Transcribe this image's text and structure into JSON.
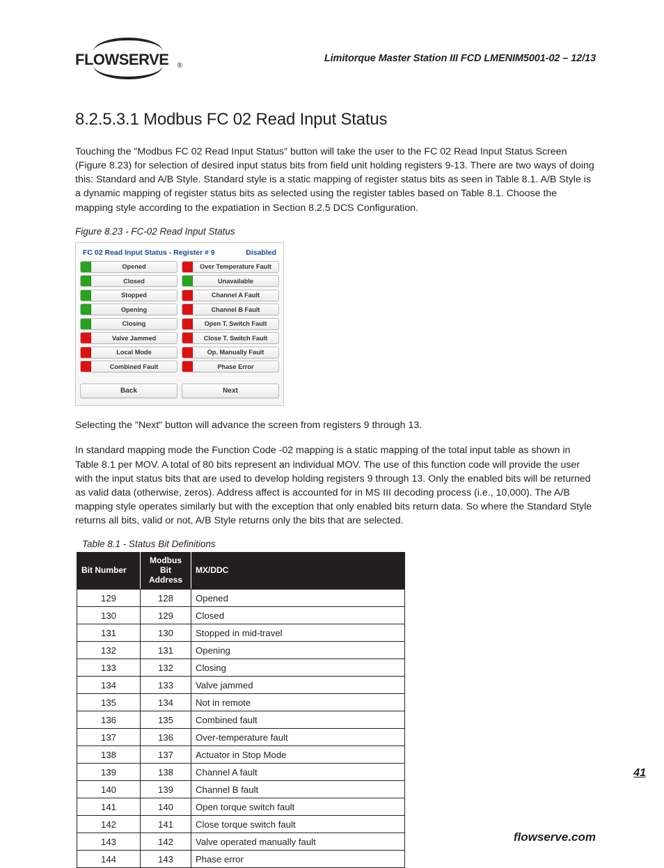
{
  "header": {
    "logo_text": "FLOWSERVE",
    "doc_id": "Limitorque Master Station III    FCD LMENIM5001-02 – 12/13"
  },
  "section": {
    "number_title": "8.2.5.3.1 Modbus FC 02 Read Input Status",
    "para1": "Touching the \"Modbus FC 02 Read Input Status\" button will take the user to the FC 02 Read Input Status Screen (Figure 8.23) for selection of desired input status bits from field unit holding registers 9-13. There are two ways of doing this: Standard and A/B Style. Standard style is a static mapping of register status bits as seen in Table 8.1. A/B Style is a dynamic mapping of register status bits as selected using the register tables based on Table 8.1. Choose the mapping style according to the expatiation in Section 8.2.5 DCS Configuration.",
    "fig_caption": "Figure 8.23 - FC-02 Read Input Status",
    "para2": "Selecting the \"Next\" button will advance the screen from registers 9 through 13.",
    "para3": "In standard mapping mode the Function Code -02 mapping is a static mapping of the total input table as shown in Table 8.1 per MOV. A total of 80 bits represent an individual MOV. The use of this function code will provide the user with the input status bits that are used to develop holding registers 9 through 13. Only the enabled bits will be returned as valid data (otherwise, zeros). Address affect is accounted for in MS III decoding process (i.e., 10,000). The A/B mapping style operates similarly but with the exception that only enabled bits return data. So where the Standard Style returns all bits, valid or not, A/B Style returns only the bits that are selected."
  },
  "figure": {
    "title_left": "FC 02 Read Input Status - Register # 9",
    "title_right": "Disabled",
    "left_items": [
      {
        "label": "Opened",
        "color": "green"
      },
      {
        "label": "Closed",
        "color": "green"
      },
      {
        "label": "Stopped",
        "color": "green"
      },
      {
        "label": "Opening",
        "color": "green"
      },
      {
        "label": "Closing",
        "color": "green"
      },
      {
        "label": "Valve Jammed",
        "color": "red"
      },
      {
        "label": "Local Mode",
        "color": "red"
      },
      {
        "label": "Combined Fault",
        "color": "red"
      }
    ],
    "right_items": [
      {
        "label": "Over Temperature Fault",
        "color": "red"
      },
      {
        "label": "Unavailable",
        "color": "green"
      },
      {
        "label": "Channel A Fault",
        "color": "red"
      },
      {
        "label": "Channel B Fault",
        "color": "red"
      },
      {
        "label": "Open T. Switch Fault",
        "color": "red"
      },
      {
        "label": "Close T. Switch Fault",
        "color": "red"
      },
      {
        "label": "Op. Manually Fault",
        "color": "red"
      },
      {
        "label": "Phase Error",
        "color": "red"
      }
    ],
    "back_btn": "Back",
    "next_btn": "Next"
  },
  "table": {
    "caption": "Table 8.1 - Status Bit Definitions",
    "headers": {
      "c1": "Bit Number",
      "c2": "Modbus Bit Address",
      "c3": "MX/DDC"
    },
    "rows": [
      {
        "bn": "129",
        "ba": "128",
        "mx": "Opened"
      },
      {
        "bn": "130",
        "ba": "129",
        "mx": "Closed"
      },
      {
        "bn": "131",
        "ba": "130",
        "mx": "Stopped in mid-travel"
      },
      {
        "bn": "132",
        "ba": "131",
        "mx": "Opening"
      },
      {
        "bn": "133",
        "ba": "132",
        "mx": "Closing"
      },
      {
        "bn": "134",
        "ba": "133",
        "mx": "Valve jammed"
      },
      {
        "bn": "135",
        "ba": "134",
        "mx": "Not in remote"
      },
      {
        "bn": "136",
        "ba": "135",
        "mx": "Combined fault"
      },
      {
        "bn": "137",
        "ba": "136",
        "mx": "Over-temperature fault"
      },
      {
        "bn": "138",
        "ba": "137",
        "mx": "Actuator in Stop Mode"
      },
      {
        "bn": "139",
        "ba": "138",
        "mx": "Channel A fault"
      },
      {
        "bn": "140",
        "ba": "139",
        "mx": "Channel B fault"
      },
      {
        "bn": "141",
        "ba": "140",
        "mx": "Open torque switch fault"
      },
      {
        "bn": "142",
        "ba": "141",
        "mx": "Close torque switch fault"
      },
      {
        "bn": "143",
        "ba": "142",
        "mx": "Valve operated manually fault"
      },
      {
        "bn": "144",
        "ba": "143",
        "mx": "Phase error"
      }
    ]
  },
  "footer": {
    "page_number": "41",
    "url": "flowserve.com"
  }
}
